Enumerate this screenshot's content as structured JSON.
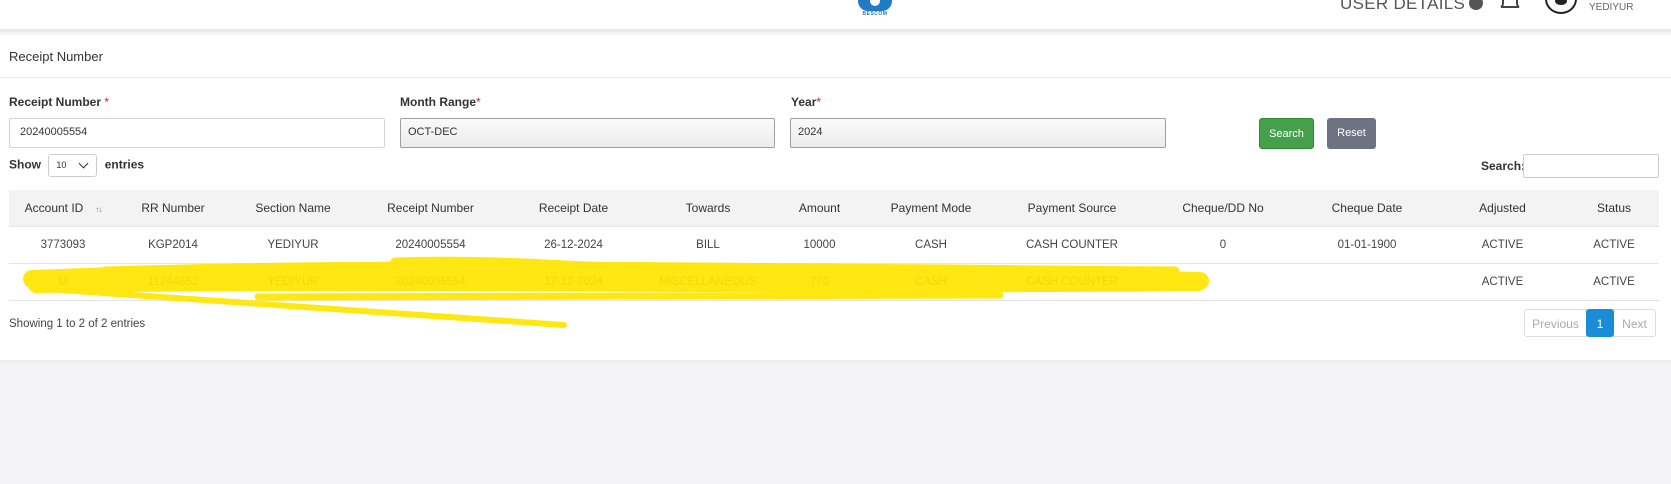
{
  "header": {
    "logo_text": "BESCOM",
    "user_details_label": "USER DETAILS",
    "username": "YEDIYUR"
  },
  "card": {
    "title": "Receipt Number"
  },
  "form": {
    "receipt_label": "Receipt Number",
    "receipt_value": "20240005554",
    "month_label": "Month Range",
    "month_value": "OCT-DEC",
    "year_label": "Year",
    "year_value": "2024",
    "required_mark": "*",
    "search_button": "Search",
    "reset_button": "Reset"
  },
  "table_controls": {
    "show_label": "Show",
    "page_size": "10",
    "entries_label": "entries",
    "search_label": "Search:",
    "search_value": ""
  },
  "table": {
    "columns": [
      "Account ID",
      "RR Number",
      "Section Name",
      "Receipt Number",
      "Receipt Date",
      "Towards",
      "Amount",
      "Payment Mode",
      "Payment Source",
      "Cheque/DD No",
      "Cheque Date",
      "Adjusted",
      "Status"
    ],
    "sort_indicator": "↑↓",
    "rows": [
      [
        "3773093",
        "KGP2014",
        "YEDIYUR",
        "20240005554",
        "26-12-2024",
        "BILL",
        "10000",
        "CASH",
        "CASH COUNTER",
        "0",
        "01-01-1900",
        "ACTIVE",
        "ACTIVE"
      ],
      [
        "M",
        "11244652",
        "YEDIYUR",
        "20240005554",
        "17-12-2024",
        "MISCELLANEOUS",
        "770",
        "CASH",
        "CASH COUNTER",
        "",
        "",
        "ACTIVE",
        "ACTIVE"
      ]
    ]
  },
  "footer": {
    "info": "Showing 1 to 2 of 2 entries",
    "prev": "Previous",
    "page": "1",
    "next": "Next"
  },
  "colors": {
    "highlight": "#ffe600",
    "search_button": "#46a04b",
    "reset_button": "#6e7383",
    "active_page": "#1a8cd8"
  }
}
